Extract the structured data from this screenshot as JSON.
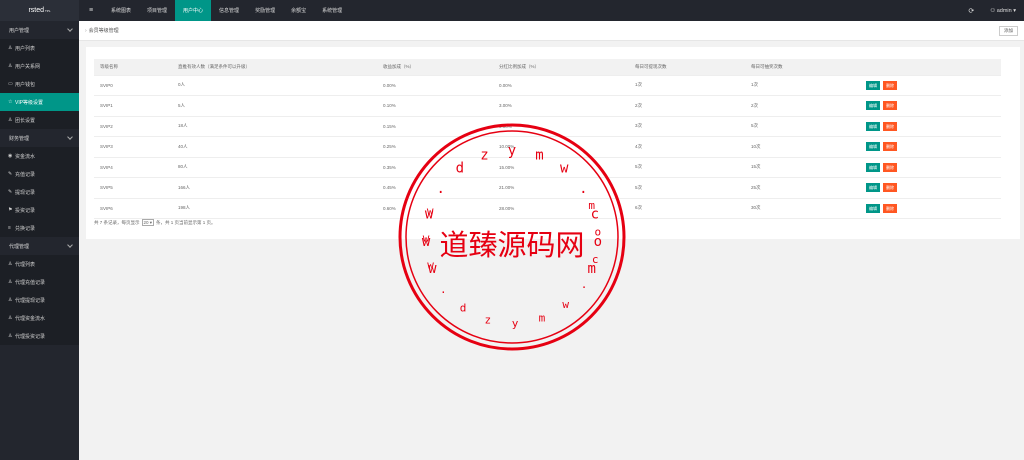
{
  "app": {
    "logo": "rsted",
    "logo_sup": "TPL"
  },
  "sidebar": {
    "groups": [
      {
        "label": "用户管理",
        "items": [
          {
            "label": "用户列表",
            "icon": "person-icon"
          },
          {
            "label": "用户关系网",
            "icon": "person-icon"
          },
          {
            "label": "用户钱包",
            "icon": "wallet-icon"
          },
          {
            "label": "VIP等级设置",
            "icon": "star-icon",
            "active": true
          },
          {
            "label": "团长设置",
            "icon": "person-icon"
          }
        ]
      },
      {
        "label": "财务管理",
        "items": [
          {
            "label": "资金流水",
            "icon": "coin-icon"
          },
          {
            "label": "充值记录",
            "icon": "tag-icon"
          },
          {
            "label": "提现记录",
            "icon": "tag-icon"
          },
          {
            "label": "投资记录",
            "icon": "flag-icon"
          },
          {
            "label": "兑换记录",
            "icon": "list-icon"
          }
        ]
      },
      {
        "label": "代理管理",
        "items": [
          {
            "label": "代理列表",
            "icon": "person-icon"
          },
          {
            "label": "代理充值记录",
            "icon": "person-icon"
          },
          {
            "label": "代理提现记录",
            "icon": "person-icon"
          },
          {
            "label": "代理资金流水",
            "icon": "person-icon"
          },
          {
            "label": "代理投资记录",
            "icon": "person-icon"
          }
        ]
      }
    ]
  },
  "topnav": {
    "items": [
      "系统图表",
      "项目管理",
      "用户中心",
      "信息管理",
      "奖励管理",
      "余额宝",
      "系统管理"
    ],
    "active_index": 2,
    "user": "admin"
  },
  "breadcrumb": {
    "title": "会员等级管理",
    "add_label": "添加"
  },
  "table": {
    "headers": [
      "等级名称",
      "直推有效人数（满足条件可以升级）",
      "收益加成（%）",
      "分红比例加成（%）",
      "每日可提现次数",
      "每日可抽奖次数",
      ""
    ],
    "rows": [
      [
        "SVIP0",
        "0人",
        "0.00%",
        "0.00%",
        "1次",
        "1次"
      ],
      [
        "SVIP1",
        "5人",
        "0.10%",
        "3.00%",
        "2次",
        "2次"
      ],
      [
        "SVIP2",
        "18人",
        "0.15%",
        "6.00%",
        "3次",
        "5次"
      ],
      [
        "SVIP3",
        "40人",
        "0.25%",
        "10.00%",
        "4次",
        "10次"
      ],
      [
        "SVIP4",
        "80人",
        "0.35%",
        "15.00%",
        "5次",
        "15次"
      ],
      [
        "SVIP5",
        "166人",
        "0.45%",
        "21.00%",
        "5次",
        "25次"
      ],
      [
        "SVIP6",
        "198人",
        "0.60%",
        "28.00%",
        "6次",
        "30次"
      ]
    ],
    "edit_label": "编辑",
    "delete_label": "删除"
  },
  "pager": {
    "prefix": "共 7 条记录，每页显示",
    "page_size": "20",
    "suffix": "条，共 1 页当前显示第 1 页。"
  },
  "watermark": {
    "text": "道臻源码网",
    "url": "www.dzymw.com"
  },
  "colors": {
    "accent": "#009688",
    "danger": "#ff5722",
    "sidebar": "#23262e",
    "watermark": "#e60012"
  }
}
